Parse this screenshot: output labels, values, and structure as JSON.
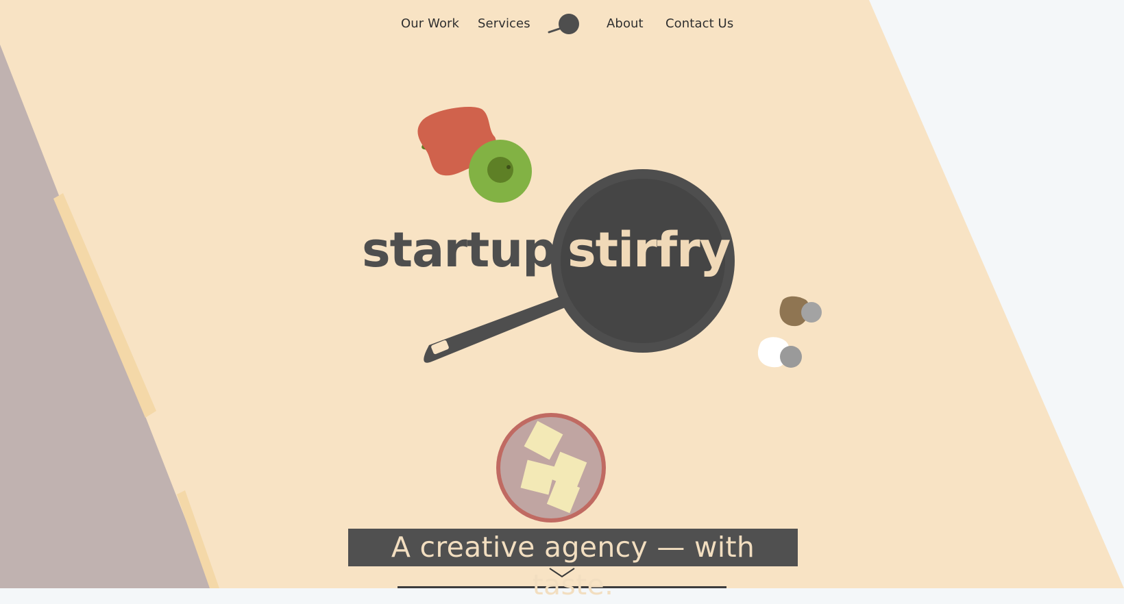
{
  "nav": {
    "items": [
      "Our Work",
      "Services",
      "About",
      "Contact Us"
    ],
    "logo_icon": "frying-pan-icon"
  },
  "hero": {
    "brand_word_1": "startup",
    "brand_word_2": "stirfry",
    "tagline": "A creative agency — with taste."
  },
  "scroll_icon": "chevron-down-icon",
  "colors": {
    "background": "#F8E3C4",
    "counter": "#C0B2B0",
    "pan": "#4E4E4E",
    "pan_inner": "#454545",
    "pan_text": "#F0D9B8",
    "red_pepper": "#D0624C",
    "green_pepper": "#82B244",
    "bowl": "#C49A98",
    "butter": "#F3E9B6",
    "page_edge": "#F4F7F9"
  }
}
